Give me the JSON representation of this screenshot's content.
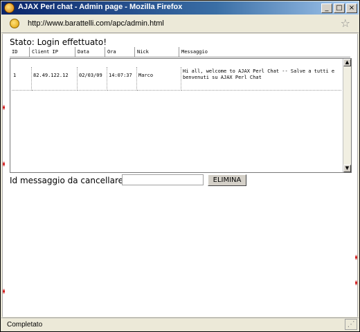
{
  "window": {
    "title": "AJAX Perl chat - Admin page - Mozilla Firefox",
    "minimize_glyph": "_",
    "maximize_glyph": "□",
    "close_glyph": "×"
  },
  "urlbar": {
    "url": "http://www.barattelli.com/apc/admin.html",
    "star_glyph": "☆"
  },
  "page": {
    "status_text": "Stato: Login effettuato!",
    "table": {
      "columns": [
        "ID",
        "Client IP",
        "Data",
        "Ora",
        "Nick",
        "Messaggio"
      ],
      "rows": [
        {
          "id": "1",
          "client_ip": "82.49.122.12",
          "data": "02/03/09",
          "ora": "14:07:37",
          "nick": "Marco",
          "messaggio": "Hi all, welcome to AJAX Perl Chat -- Salve a tutti e benvenuti su AJAX Perl Chat"
        }
      ]
    },
    "scroll_up_glyph": "▲",
    "scroll_down_glyph": "▼",
    "delete": {
      "label": "Id messaggio da cancellare :",
      "input_value": "",
      "button_label": "ELIMINA"
    }
  },
  "statusbar": {
    "text": "Completato"
  },
  "icons": {
    "title_icon": "firefox-icon",
    "url_icon": "site-favicon",
    "star_icon": "bookmark-star-icon",
    "grip_icon": "resize-grip-icon"
  }
}
